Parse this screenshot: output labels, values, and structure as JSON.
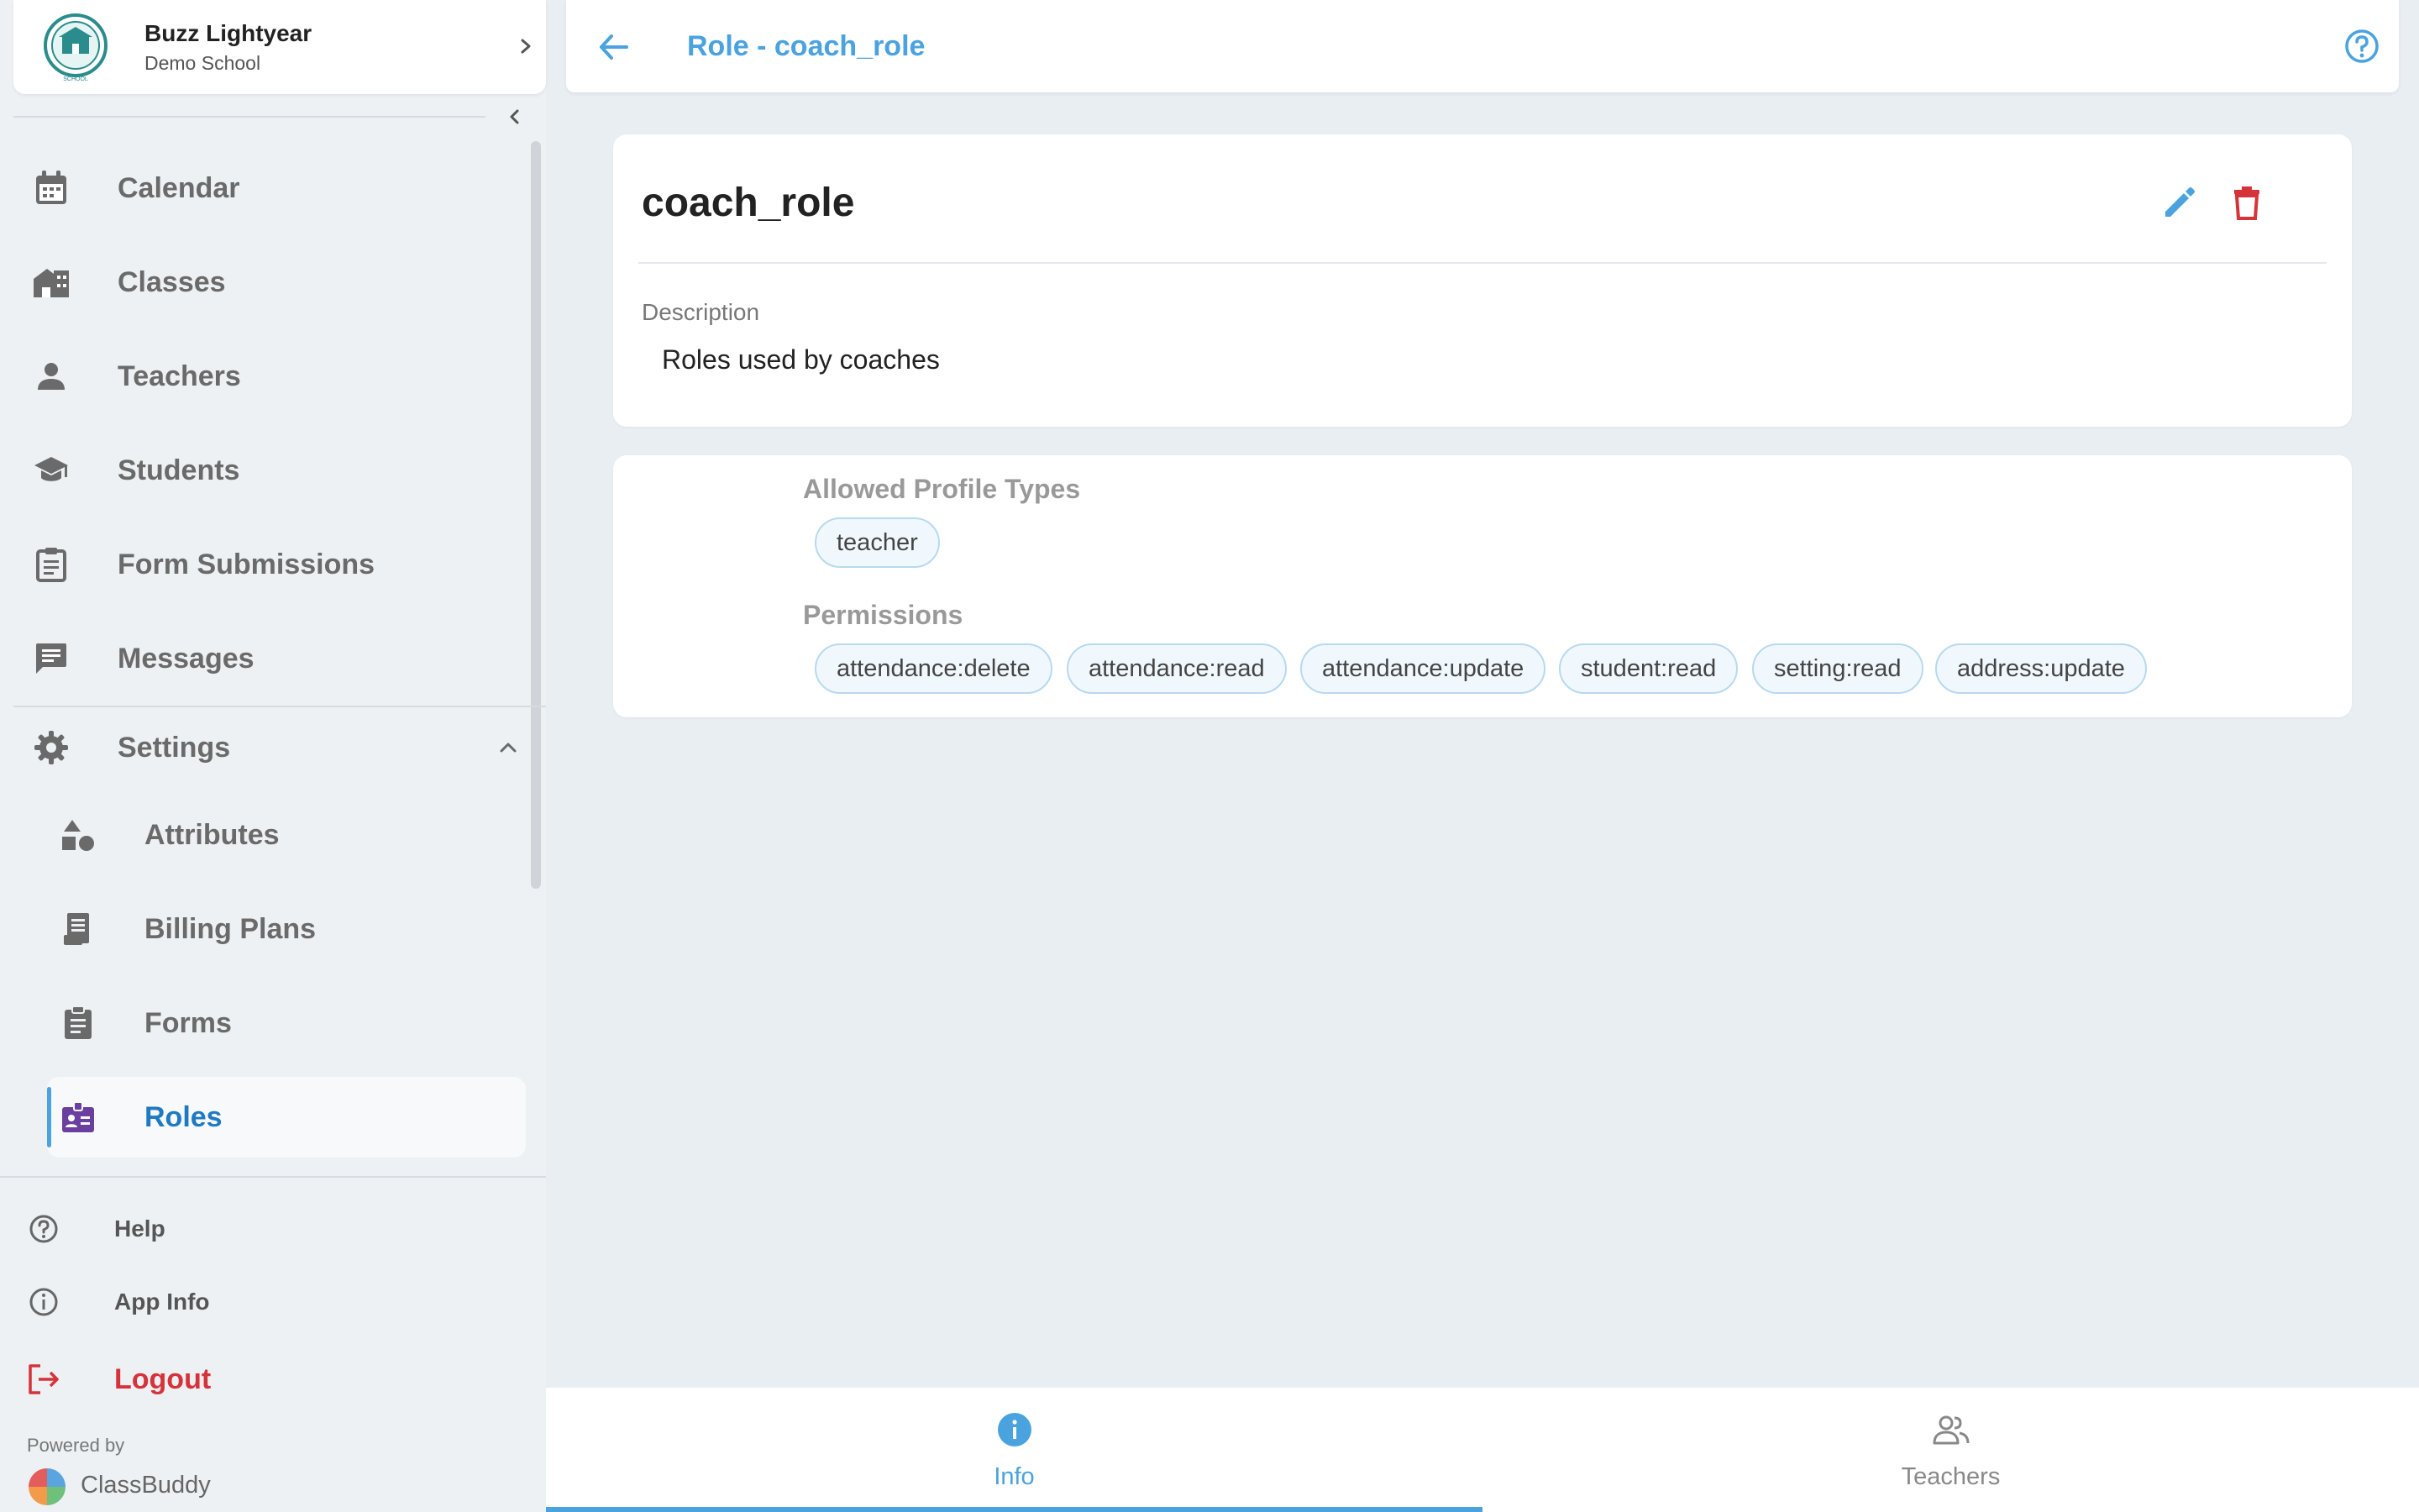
{
  "colors": {
    "accent": "#4aa3df",
    "active_text": "#1f7ac2",
    "danger": "#d6323a",
    "roles_icon": "#6b3fa0",
    "background": "#e9eef3"
  },
  "profile": {
    "name": "Buzz Lightyear",
    "school": "Demo School",
    "logo_text": "SCHOOL"
  },
  "sidebar": {
    "items": [
      {
        "label": "Calendar",
        "icon": "calendar-icon"
      },
      {
        "label": "Classes",
        "icon": "classes-icon"
      },
      {
        "label": "Teachers",
        "icon": "person-icon"
      },
      {
        "label": "Students",
        "icon": "graduation-cap-icon"
      },
      {
        "label": "Form Submissions",
        "icon": "clipboard-list-icon"
      },
      {
        "label": "Messages",
        "icon": "message-icon"
      }
    ],
    "settings": {
      "label": "Settings",
      "icon": "gear-icon",
      "expanded": true,
      "children": [
        {
          "label": "Attributes",
          "icon": "shapes-icon"
        },
        {
          "label": "Billing Plans",
          "icon": "receipt-icon"
        },
        {
          "label": "Forms",
          "icon": "clipboard-icon"
        },
        {
          "label": "Roles",
          "icon": "badge-icon",
          "active": true
        }
      ]
    },
    "bottom": {
      "help": "Help",
      "app_info": "App Info",
      "logout": "Logout"
    },
    "powered_by": "Powered by",
    "brand": "ClassBuddy"
  },
  "header": {
    "title": "Role - coach_role"
  },
  "role": {
    "name": "coach_role",
    "description_label": "Description",
    "description": "Roles used by coaches",
    "allowed_profile_types_label": "Allowed Profile Types",
    "allowed_profile_types": [
      "teacher"
    ],
    "permissions_label": "Permissions",
    "permissions": [
      "attendance:delete",
      "attendance:read",
      "attendance:update",
      "student:read",
      "setting:read",
      "address:update"
    ]
  },
  "tabs": [
    {
      "label": "Info",
      "icon": "info-icon",
      "active": true
    },
    {
      "label": "Teachers",
      "icon": "people-icon",
      "active": false
    }
  ]
}
